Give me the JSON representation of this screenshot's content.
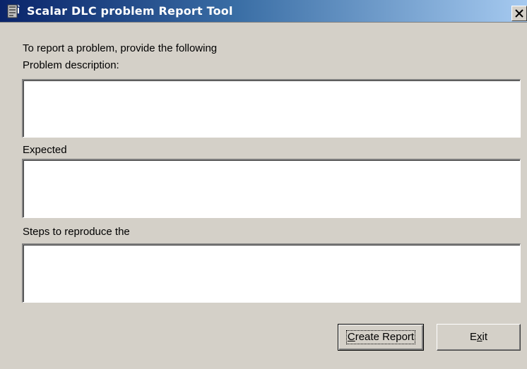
{
  "window": {
    "title": "Scalar DLC problem Report Tool",
    "icon": "report-tool-app-icon",
    "close_label": "×"
  },
  "form": {
    "intro_line_1": "To report a problem, provide the following",
    "problem_label": "Problem description:",
    "problem_value": "",
    "expected_label": "Expected",
    "expected_value": "",
    "steps_label": "Steps to reproduce the",
    "steps_value": ""
  },
  "buttons": {
    "create_report": {
      "before": "",
      "accel": "C",
      "after": "reate Report"
    },
    "exit": {
      "before": "E",
      "accel": "x",
      "after": "it"
    }
  },
  "colors": {
    "face": "#d4d0c8",
    "title_start": "#0a246a",
    "title_end": "#a6caf0",
    "field_bg": "#ffffff"
  }
}
